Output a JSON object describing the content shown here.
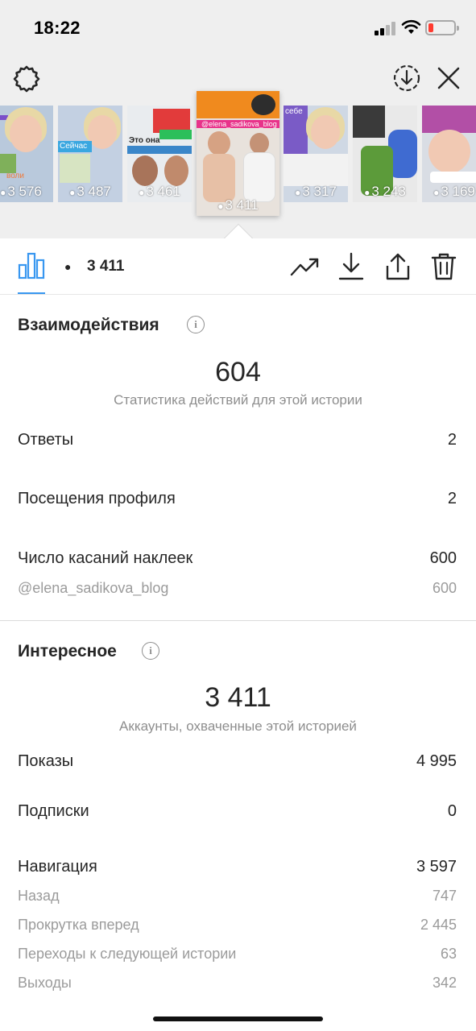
{
  "status_bar": {
    "time": "18:22"
  },
  "thumbnails": [
    {
      "views": "3 576",
      "overlay": "воли"
    },
    {
      "views": "3 487",
      "overlay": "Сейчас"
    },
    {
      "views": "3 461",
      "overlay": "Это она"
    },
    {
      "views": "3 411",
      "overlay": "@elena_sadikova_blog",
      "selected": true
    },
    {
      "views": "3 317",
      "overlay": "себе"
    },
    {
      "views": "3 243",
      "overlay": ""
    },
    {
      "views": "3 169",
      "overlay": ""
    }
  ],
  "toolbar": {
    "views_count": "3 411"
  },
  "interactions": {
    "title": "Взаимодействия",
    "total": "604",
    "caption": "Статистика действий для этой истории",
    "rows": [
      {
        "label": "Ответы",
        "value": "2"
      },
      {
        "label": "Посещения профиля",
        "value": "2"
      },
      {
        "label": "Число касаний наклеек",
        "value": "600"
      }
    ],
    "sub_rows": [
      {
        "label": "@elena_sadikova_blog",
        "value": "600"
      }
    ]
  },
  "discovery": {
    "title": "Интересное",
    "total": "3 411",
    "caption": "Аккаунты, охваченные этой историей",
    "rows": [
      {
        "label": "Показы",
        "value": "4 995"
      },
      {
        "label": "Подписки",
        "value": "0"
      },
      {
        "label": "Навигация",
        "value": "3 597"
      }
    ],
    "sub_rows": [
      {
        "label": "Назад",
        "value": "747"
      },
      {
        "label": "Прокрутка вперед",
        "value": "2 445"
      },
      {
        "label": "Переходы к следующей истории",
        "value": "63"
      },
      {
        "label": "Выходы",
        "value": "342"
      }
    ]
  },
  "colors": {
    "accent": "#3897f0",
    "battery_low": "#ff3b30",
    "muted_text": "#8e8e8e"
  },
  "icons": [
    "gear-icon",
    "download-circle-icon",
    "close-icon",
    "bar-chart-icon",
    "eye-icon",
    "trending-icon",
    "download-icon",
    "share-icon",
    "trash-icon",
    "info-icon"
  ]
}
